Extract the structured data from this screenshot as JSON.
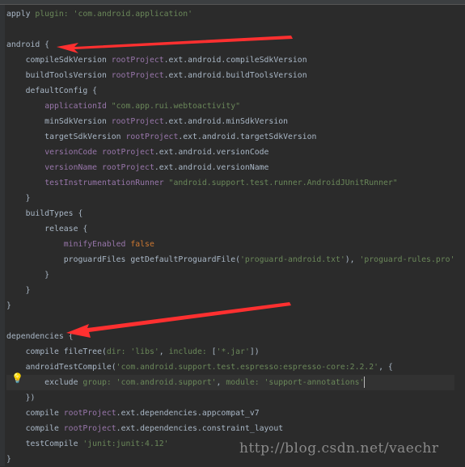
{
  "editor": {
    "lines": [
      [
        [
          "apply ",
          "k"
        ],
        [
          "plugin: ",
          "n"
        ],
        [
          "'com.android.application'",
          "s"
        ]
      ],
      [],
      [
        [
          "android {",
          "k"
        ]
      ],
      [
        [
          "    compileSdkVersion ",
          "k"
        ],
        [
          "rootProject",
          "p"
        ],
        [
          ".ext.android.compileSdkVersion",
          "k"
        ]
      ],
      [
        [
          "    buildToolsVersion ",
          "k"
        ],
        [
          "rootProject",
          "p"
        ],
        [
          ".ext.android.buildToolsVersion",
          "k"
        ]
      ],
      [
        [
          "    defaultConfig {",
          "k"
        ]
      ],
      [
        [
          "        ",
          "k"
        ],
        [
          "applicationId ",
          "p"
        ],
        [
          "\"com.app.rui.webtoactivity\"",
          "s"
        ]
      ],
      [
        [
          "        minSdkVersion ",
          "k"
        ],
        [
          "rootProject",
          "p"
        ],
        [
          ".ext.android.minSdkVersion",
          "k"
        ]
      ],
      [
        [
          "        targetSdkVersion ",
          "k"
        ],
        [
          "rootProject",
          "p"
        ],
        [
          ".ext.android.targetSdkVersion",
          "k"
        ]
      ],
      [
        [
          "        ",
          "k"
        ],
        [
          "versionCode ",
          "p"
        ],
        [
          "rootProject",
          "p"
        ],
        [
          ".ext.android.versionCode",
          "k"
        ]
      ],
      [
        [
          "        ",
          "k"
        ],
        [
          "versionName ",
          "p"
        ],
        [
          "rootProject",
          "p"
        ],
        [
          ".ext.android.versionName",
          "k"
        ]
      ],
      [
        [
          "        ",
          "k"
        ],
        [
          "testInstrumentationRunner ",
          "p"
        ],
        [
          "\"android.support.test.runner.AndroidJUnitRunner\"",
          "s"
        ]
      ],
      [
        [
          "    }",
          "k"
        ]
      ],
      [
        [
          "    buildTypes {",
          "k"
        ]
      ],
      [
        [
          "        release {",
          "k"
        ]
      ],
      [
        [
          "            ",
          "k"
        ],
        [
          "minifyEnabled ",
          "p"
        ],
        [
          "false",
          "o"
        ]
      ],
      [
        [
          "            proguardFiles getDefaultProguardFile(",
          "k"
        ],
        [
          "'proguard-android.txt'",
          "s"
        ],
        [
          "), ",
          "k"
        ],
        [
          "'proguard-rules.pro'",
          "s"
        ]
      ],
      [
        [
          "        }",
          "k"
        ]
      ],
      [
        [
          "    }",
          "k"
        ]
      ],
      [
        [
          "}",
          "k"
        ]
      ],
      [],
      [
        [
          "dependencies {",
          "k"
        ]
      ],
      [
        [
          "    compile fileTree(",
          "k"
        ],
        [
          "dir: ",
          "n"
        ],
        [
          "'libs'",
          "s"
        ],
        [
          ", ",
          "k"
        ],
        [
          "include: ",
          "n"
        ],
        [
          "[",
          "k"
        ],
        [
          "'*.jar'",
          "s"
        ],
        [
          "])",
          "k"
        ]
      ],
      [
        [
          "    androidTestCompile(",
          "k"
        ],
        [
          "'com.android.support.test.espresso:espresso-core:2.2.2'",
          "s"
        ],
        [
          ", {",
          "k"
        ]
      ],
      [
        [
          "        exclude ",
          "k"
        ],
        [
          "group: ",
          "n"
        ],
        [
          "'com.android.support'",
          "s"
        ],
        [
          ", ",
          "k"
        ],
        [
          "module: ",
          "n"
        ],
        [
          "'support-annotations'",
          "s"
        ]
      ],
      [
        [
          "    })",
          "k"
        ]
      ],
      [
        [
          "    compile ",
          "k"
        ],
        [
          "rootProject",
          "p"
        ],
        [
          ".ext.dependencies.appcompat_v7",
          "k"
        ]
      ],
      [
        [
          "    compile ",
          "k"
        ],
        [
          "rootProject",
          "p"
        ],
        [
          ".ext.dependencies.constraint_layout",
          "k"
        ]
      ],
      [
        [
          "    testCompile ",
          "k"
        ],
        [
          "'junit:junit:4.12'",
          "s"
        ]
      ],
      [
        [
          "}",
          "k"
        ]
      ]
    ],
    "highlighted_line": 25,
    "colors": {
      "background": "#2b2b2b",
      "text": "#a9b7c6",
      "property": "#9876aa",
      "string": "#6a8759",
      "keyword": "#cc7832",
      "arrow": "#ff3030"
    }
  },
  "watermark": "http://blog.csdn.net/vaechr",
  "icons": {
    "intention": "lightbulb-icon"
  }
}
